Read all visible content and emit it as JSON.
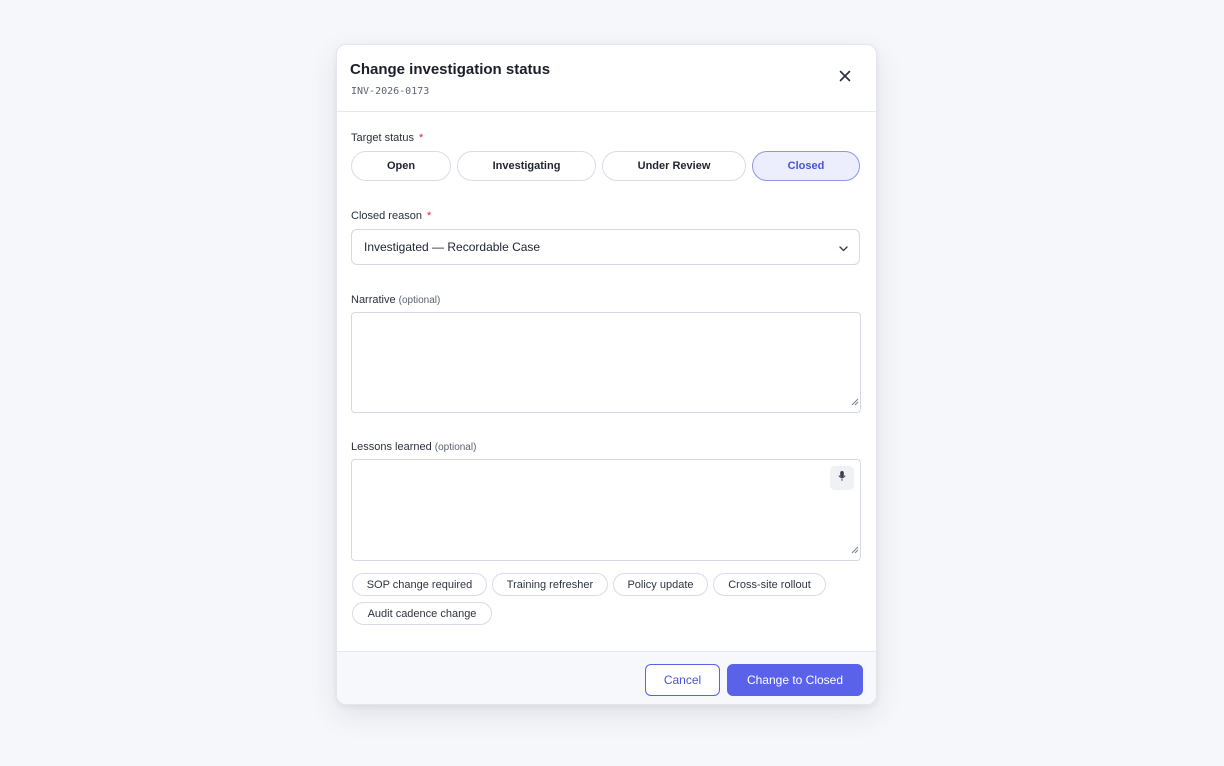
{
  "modal": {
    "title": "Change investigation status",
    "record_id": "INV-2026-0173"
  },
  "target_status": {
    "label": "Target status",
    "required_mark": "*",
    "options": [
      "Open",
      "Investigating",
      "Under Review",
      "Closed"
    ],
    "selected": "Closed"
  },
  "closed_reason": {
    "label": "Closed reason",
    "required_mark": "*",
    "value": "Investigated — Recordable Case"
  },
  "narrative": {
    "label": "Narrative",
    "optional_label": "(optional)",
    "value": ""
  },
  "lessons_learned": {
    "label": "Lessons learned",
    "optional_label": "(optional)",
    "value": "",
    "suggestions": [
      "SOP change required",
      "Training refresher",
      "Policy update",
      "Cross-site rollout",
      "Audit cadence change"
    ]
  },
  "footer": {
    "cancel_label": "Cancel",
    "submit_label": "Change to Closed"
  },
  "colors": {
    "accent": "#5a62ea",
    "selected_bg": "#eceefd",
    "required": "#d6263a",
    "page_bg": "#f6f7fb"
  },
  "icons": {
    "close": "close-icon",
    "dropdown": "chevron-down-icon",
    "dictation": "microphone-icon",
    "resize": "resize-handle-icon"
  }
}
